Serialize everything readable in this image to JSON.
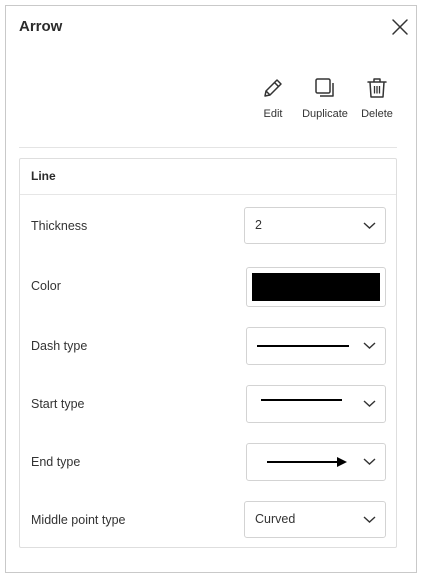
{
  "panel": {
    "title": "Arrow"
  },
  "actions": [
    {
      "label": "Edit",
      "icon": "pencil-icon"
    },
    {
      "label": "Duplicate",
      "icon": "duplicate-icon"
    },
    {
      "label": "Delete",
      "icon": "trash-icon"
    }
  ],
  "line_section": {
    "title": "Line",
    "thickness": {
      "label": "Thickness",
      "value": "2"
    },
    "color": {
      "label": "Color",
      "value": "#000000"
    },
    "dash_type": {
      "label": "Dash type",
      "value": "solid"
    },
    "start_type": {
      "label": "Start type",
      "value": "none"
    },
    "end_type": {
      "label": "End type",
      "value": "arrow"
    },
    "middle_point_type": {
      "label": "Middle point type",
      "value": "Curved"
    }
  },
  "colors": {
    "text": "#2b2b2b",
    "border": "#d3d3d3"
  }
}
